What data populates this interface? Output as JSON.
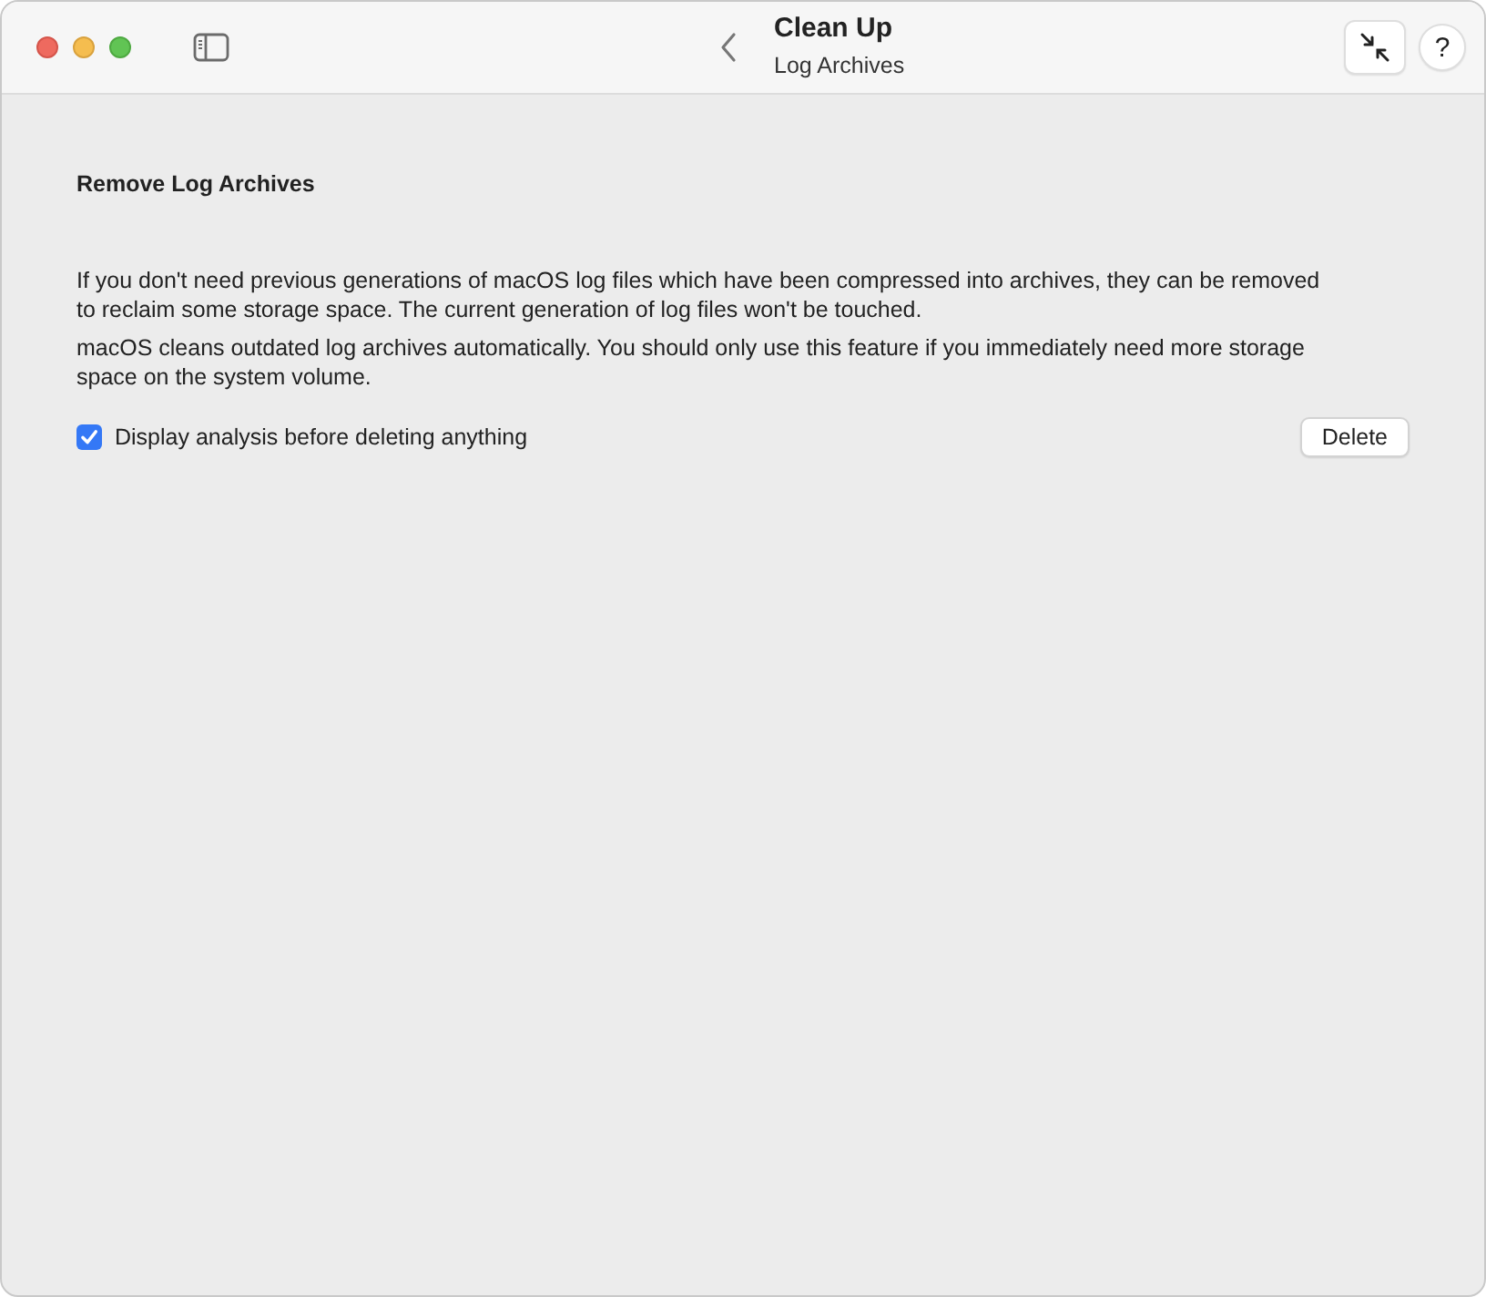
{
  "window": {
    "title": "Clean Up",
    "subtitle": "Log Archives"
  },
  "section": {
    "heading": "Remove Log Archives",
    "paragraphs": [
      "If you don't need previous generations of macOS log files which have been compressed into archives, they can be removed to reclaim some storage space. The current generation of log files won't be touched.",
      "macOS cleans outdated log archives automatically. You should only use this feature if you immediately need more storage space on the system volume."
    ],
    "option": {
      "label": "Display analysis before deleting anything",
      "checked": true
    },
    "button": "Delete"
  },
  "toolbar": {
    "help": "?"
  }
}
